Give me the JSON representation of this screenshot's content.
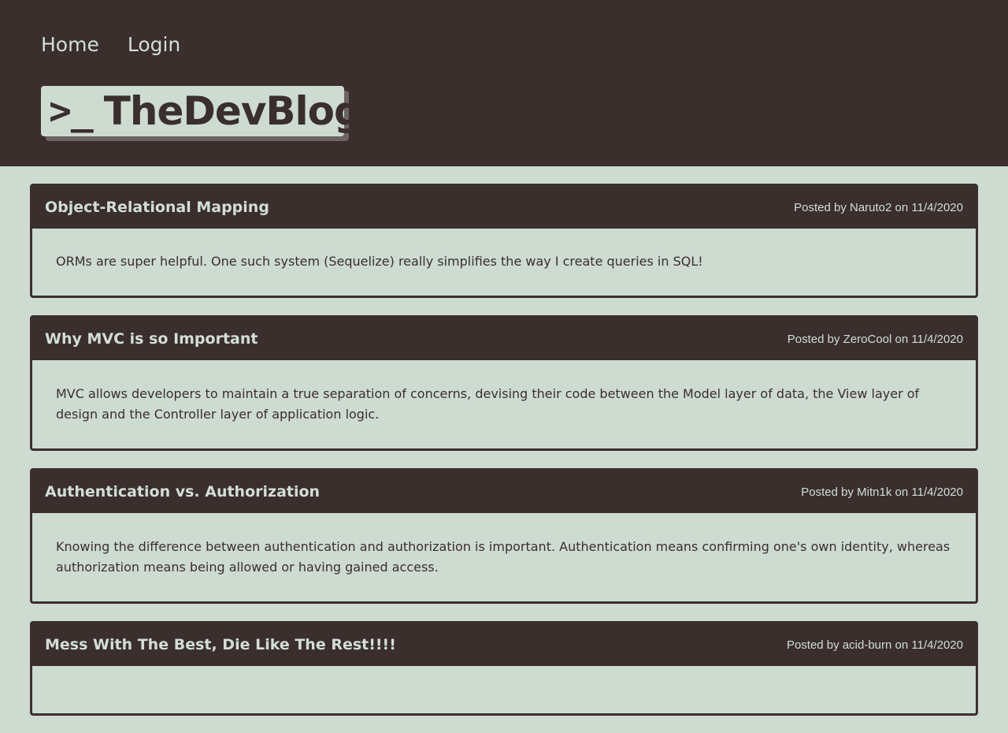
{
  "nav": {
    "home": "Home",
    "login": "Login"
  },
  "logo": {
    "prompt": ">_",
    "title": "TheDevBlog"
  },
  "posts": [
    {
      "title": "Object-Relational Mapping",
      "meta": "Posted by Naruto2 on 11/4/2020",
      "body": "ORMs are super helpful. One such system (Sequelize) really simplifies the way I create queries in SQL!"
    },
    {
      "title": "Why MVC is so Important",
      "meta": "Posted by ZeroCool on 11/4/2020",
      "body": "MVC allows developers to maintain a true separation of concerns, devising their code between the Model layer of data, the View layer of design and the Controller layer of application logic."
    },
    {
      "title": "Authentication vs. Authorization",
      "meta": "Posted by Mitn1k on 11/4/2020",
      "body": "Knowing the difference between authentication and authorization is important. Authentication means confirming one's own identity, whereas authorization means being allowed or having gained access."
    },
    {
      "title": "Mess With The Best, Die Like The Rest!!!!",
      "meta": "Posted by acid-burn on 11/4/2020",
      "body": ""
    }
  ],
  "colors": {
    "dark": "#3a2f2d",
    "light": "#cddbd1",
    "text_light": "#d2ded6"
  }
}
